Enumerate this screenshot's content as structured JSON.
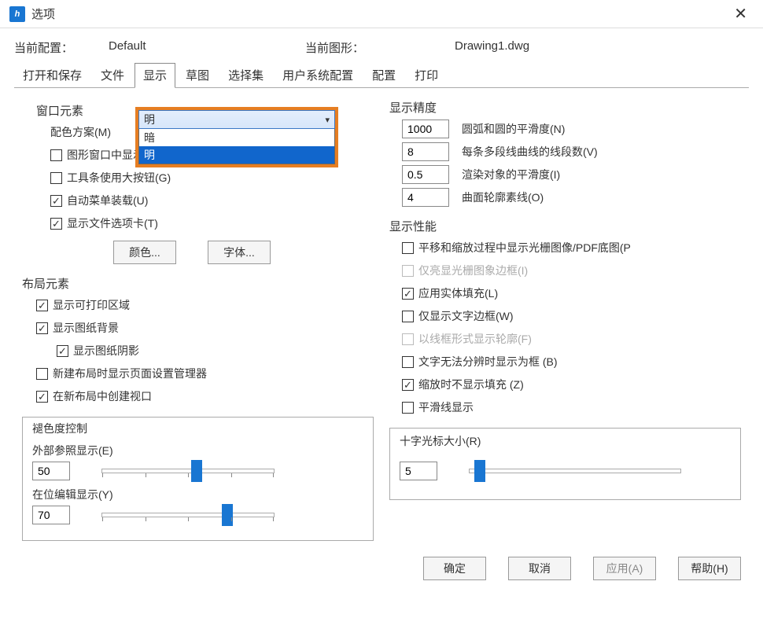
{
  "window": {
    "title": "选项",
    "close_glyph": "✕"
  },
  "info": {
    "config_label": "当前配置：",
    "config_value": "Default",
    "drawing_label": "当前图形：",
    "drawing_value": "Drawing1.dwg"
  },
  "tabs": [
    "打开和保存",
    "文件",
    "显示",
    "草图",
    "选择集",
    "用户系统配置",
    "配置",
    "打印"
  ],
  "active_tab": "显示",
  "left": {
    "window_elements": {
      "title": "窗口元素",
      "color_scheme_label": "配色方案(M)",
      "dropdown": {
        "selected": "明",
        "options": [
          "暗",
          "明"
        ]
      },
      "chk_scrollbar": "图形窗口中显示滚动条(S)",
      "chk_bigbtn": "工具条使用大按钮(G)",
      "chk_automenu": "自动菜单装载(U)",
      "chk_filetabs": "显示文件选项卡(T)",
      "btn_color": "颜色...",
      "btn_font": "字体..."
    },
    "layout_elements": {
      "title": "布局元素",
      "chk_printable": "显示可打印区域",
      "chk_paperbg": "显示图纸背景",
      "chk_papershadow": "显示图纸阴影",
      "chk_pagesetup": "新建布局时显示页面设置管理器",
      "chk_createvp": "在新布局中创建视口"
    },
    "fade": {
      "title": "褪色度控制",
      "xref_label": "外部参照显示(E)",
      "xref_value": "50",
      "inplace_label": "在位编辑显示(Y)",
      "inplace_value": "70"
    }
  },
  "right": {
    "precision": {
      "title": "显示精度",
      "arc_value": "1000",
      "arc_label": "圆弧和圆的平滑度(N)",
      "seg_value": "8",
      "seg_label": "每条多段线曲线的线段数(V)",
      "render_value": "0.5",
      "render_label": "渲染对象的平滑度(I)",
      "contour_value": "4",
      "contour_label": "曲面轮廓素线(O)"
    },
    "performance": {
      "title": "显示性能",
      "chk_panzoom": "平移和缩放过程中显示光栅图像/PDF底图(P",
      "chk_rasterframe": "仅亮显光栅图象边框(I)",
      "chk_solidfill": "应用实体填充(L)",
      "chk_textframe": "仅显示文字边框(W)",
      "chk_wireframe": "以线框形式显示轮廓(F)",
      "chk_textasbox": "文字无法分辨时显示为框 (B)",
      "chk_zoomfill": "缩放时不显示填充 (Z)",
      "chk_smoothline": "平滑线显示"
    },
    "crosshair": {
      "title": "十字光标大小(R)",
      "value": "5"
    }
  },
  "footer": {
    "ok": "确定",
    "cancel": "取消",
    "apply": "应用(A)",
    "help": "帮助(H)"
  }
}
